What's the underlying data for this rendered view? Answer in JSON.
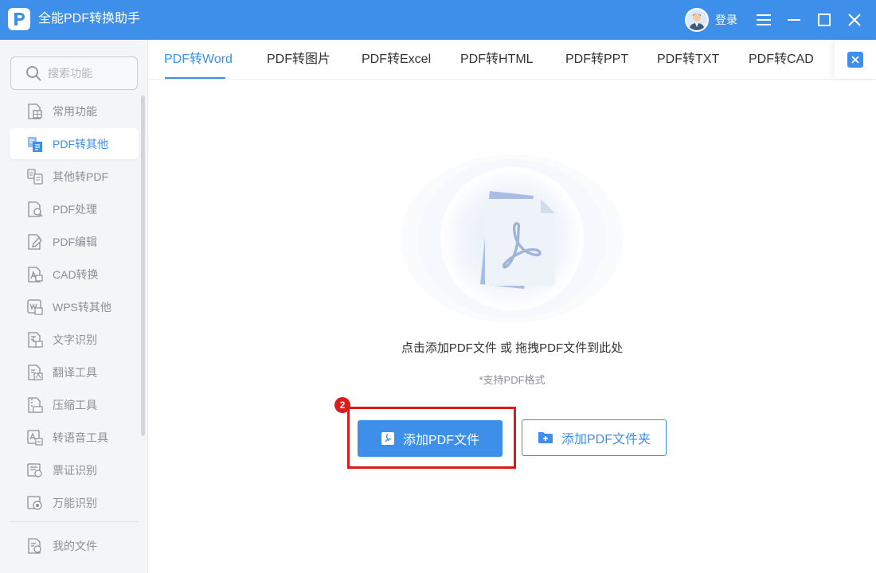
{
  "app": {
    "title": "全能PDF转换助手",
    "login_label": "登录",
    "accent_color": "#3d8fe9",
    "icons": {
      "logo": "pdf-logo-icon",
      "menu": "menu-icon",
      "minimize": "minimize-icon",
      "maximize": "maximize-icon",
      "close": "close-icon"
    }
  },
  "sidebar": {
    "search_placeholder": "搜索功能",
    "items": [
      {
        "label": "常用功能",
        "icon": "common-functions-icon",
        "active": false
      },
      {
        "label": "PDF转其他",
        "icon": "pdf-to-other-icon",
        "active": true
      },
      {
        "label": "其他转PDF",
        "icon": "other-to-pdf-icon",
        "active": false
      },
      {
        "label": "PDF处理",
        "icon": "pdf-process-icon",
        "active": false
      },
      {
        "label": "PDF编辑",
        "icon": "pdf-edit-icon",
        "active": false
      },
      {
        "label": "CAD转换",
        "icon": "cad-convert-icon",
        "active": false
      },
      {
        "label": "WPS转其他",
        "icon": "wps-convert-icon",
        "active": false
      },
      {
        "label": "文字识别",
        "icon": "text-recognition-icon",
        "active": false
      },
      {
        "label": "翻译工具",
        "icon": "translate-icon",
        "active": false
      },
      {
        "label": "压缩工具",
        "icon": "compress-icon",
        "active": false
      },
      {
        "label": "转语音工具",
        "icon": "speech-icon",
        "active": false
      },
      {
        "label": "票证识别",
        "icon": "ticket-recognition-icon",
        "active": false
      },
      {
        "label": "万能识别",
        "icon": "universal-recognition-icon",
        "active": false
      }
    ],
    "footer_item": {
      "label": "我的文件",
      "icon": "my-files-icon"
    }
  },
  "tabs": [
    {
      "label": "PDF转Word",
      "active": true
    },
    {
      "label": "PDF转图片",
      "active": false
    },
    {
      "label": "PDF转Excel",
      "active": false
    },
    {
      "label": "PDF转HTML",
      "active": false
    },
    {
      "label": "PDF转PPT",
      "active": false
    },
    {
      "label": "PDF转TXT",
      "active": false
    },
    {
      "label": "PDF转CAD",
      "active": false
    }
  ],
  "main": {
    "drop_hint": "点击添加PDF文件 或 拖拽PDF文件到此处",
    "format_hint": "*支持PDF格式",
    "add_file_label": "添加PDF文件",
    "add_folder_label": "添加PDF文件夹",
    "step_badge": "2",
    "highlight_color": "#e01818"
  }
}
